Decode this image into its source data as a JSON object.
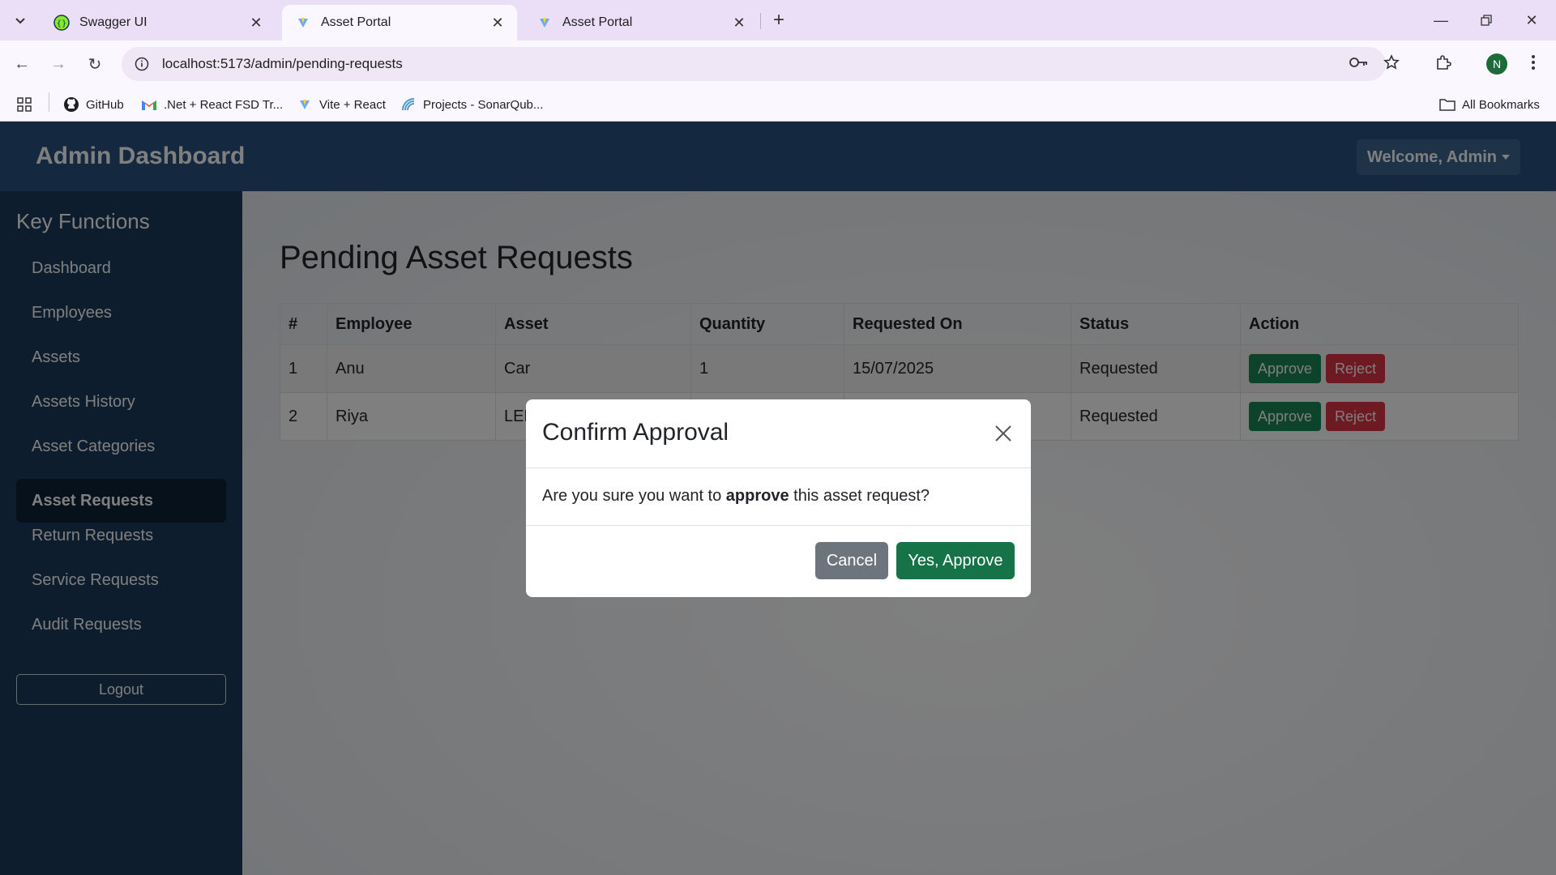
{
  "browser": {
    "tabs": [
      {
        "title": "Swagger UI",
        "icon": "swagger-icon",
        "active": false
      },
      {
        "title": "Asset Portal",
        "icon": "vite-icon",
        "active": true
      },
      {
        "title": "Asset Portal",
        "icon": "vite-icon",
        "active": false
      }
    ],
    "url": "localhost:5173/admin/pending-requests",
    "bookmarks": [
      {
        "label": "GitHub",
        "icon": "github-icon"
      },
      {
        "label": ".Net + React FSD Tr...",
        "icon": "gmail-icon"
      },
      {
        "label": "Vite + React",
        "icon": "vite-icon"
      },
      {
        "label": "Projects - SonarQub...",
        "icon": "sonarqube-icon"
      }
    ],
    "all_bookmarks": "All Bookmarks",
    "profile_initial": "N"
  },
  "header": {
    "brand": "Admin Dashboard",
    "welcome": "Welcome, Admin"
  },
  "sidebar": {
    "title": "Key Functions",
    "items": [
      {
        "label": "Dashboard",
        "active": false
      },
      {
        "label": "Employees",
        "active": false
      },
      {
        "label": "Assets",
        "active": false
      },
      {
        "label": "Assets History",
        "active": false
      },
      {
        "label": "Asset Categories",
        "active": false
      },
      {
        "label": "Asset Requests",
        "active": true
      },
      {
        "label": "Return Requests",
        "active": false
      },
      {
        "label": "Service Requests",
        "active": false
      },
      {
        "label": "Audit Requests",
        "active": false
      }
    ],
    "logout": "Logout"
  },
  "main": {
    "title": "Pending Asset Requests",
    "table": {
      "headers": [
        "#",
        "Employee",
        "Asset",
        "Quantity",
        "Requested On",
        "Status",
        "Action"
      ],
      "rows": [
        {
          "num": "1",
          "employee": "Anu",
          "asset": "Car",
          "quantity": "1",
          "requested_on": "15/07/2025",
          "status": "Requested"
        },
        {
          "num": "2",
          "employee": "Riya",
          "asset": "LED",
          "quantity": "",
          "requested_on": "",
          "status": "Requested"
        }
      ],
      "approve_label": "Approve",
      "reject_label": "Reject"
    }
  },
  "modal": {
    "title": "Confirm Approval",
    "body_prefix": "Are you sure you want to ",
    "body_bold": "approve",
    "body_suffix": " this asset request?",
    "cancel": "Cancel",
    "confirm": "Yes, Approve"
  },
  "colors": {
    "header": "#28527f",
    "sidebar": "#1c3a5c",
    "approve": "#198754",
    "reject": "#dc3545",
    "cancel": "#6c757d"
  }
}
